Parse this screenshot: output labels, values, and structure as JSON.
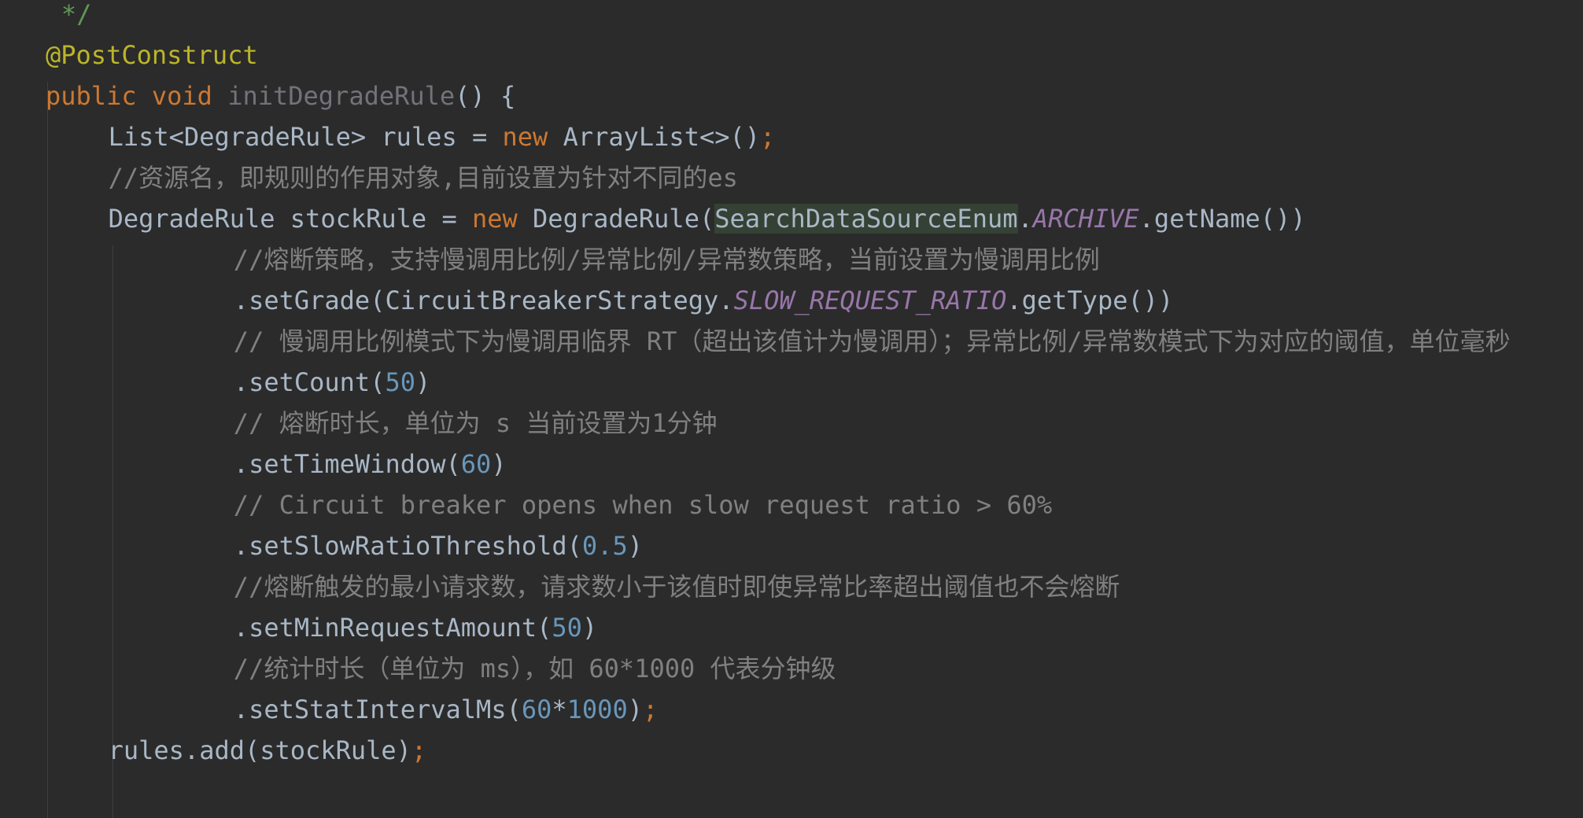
{
  "editor": {
    "lines": [
      {
        "indent": 1,
        "tokens": [
          {
            "t": "*/",
            "c": "doc"
          }
        ]
      },
      {
        "indent": 0,
        "tokens": [
          {
            "t": "@PostConstruct",
            "c": "annotation"
          }
        ]
      },
      {
        "indent": 0,
        "tokens": [
          {
            "t": "public",
            "c": "keyword"
          },
          {
            "t": " ",
            "c": "plain"
          },
          {
            "t": "void",
            "c": "keyword"
          },
          {
            "t": " ",
            "c": "plain"
          },
          {
            "t": "initDegradeRule",
            "c": "unused"
          },
          {
            "t": "() {",
            "c": "plain"
          }
        ]
      },
      {
        "indent": 4,
        "tokens": [
          {
            "t": "List<DegradeRule> rules = ",
            "c": "plain"
          },
          {
            "t": "new",
            "c": "keyword"
          },
          {
            "t": " ArrayList<>()",
            "c": "plain"
          },
          {
            "t": ";",
            "c": "semi"
          }
        ]
      },
      {
        "indent": 4,
        "tokens": [
          {
            "t": "//资源名，即规则的作用对象,目前设置为针对不同的es",
            "c": "comment"
          }
        ]
      },
      {
        "indent": 4,
        "tokens": [
          {
            "t": "DegradeRule stockRule = ",
            "c": "plain"
          },
          {
            "t": "new",
            "c": "keyword"
          },
          {
            "t": " DegradeRule(",
            "c": "plain"
          },
          {
            "t": "SearchDataSourceEnum",
            "c": "highlight"
          },
          {
            "t": ".",
            "c": "plain"
          },
          {
            "t": "ARCHIVE",
            "c": "const"
          },
          {
            "t": ".getName())",
            "c": "plain"
          }
        ]
      },
      {
        "indent": 12,
        "tokens": [
          {
            "t": "//熔断策略，支持慢调用比例/异常比例/异常数策略，当前设置为慢调用比例",
            "c": "comment"
          }
        ]
      },
      {
        "indent": 12,
        "tokens": [
          {
            "t": ".setGrade(CircuitBreakerStrategy.",
            "c": "plain"
          },
          {
            "t": "SLOW_REQUEST_RATIO",
            "c": "const"
          },
          {
            "t": ".getType())",
            "c": "plain"
          }
        ]
      },
      {
        "indent": 12,
        "tokens": [
          {
            "t": "// 慢调用比例模式下为慢调用临界 RT（超出该值计为慢调用）；异常比例/异常数模式下为对应的阈值，单位毫秒",
            "c": "comment"
          }
        ]
      },
      {
        "indent": 12,
        "tokens": [
          {
            "t": ".setCount(",
            "c": "plain"
          },
          {
            "t": "50",
            "c": "number"
          },
          {
            "t": ")",
            "c": "plain"
          }
        ]
      },
      {
        "indent": 12,
        "tokens": [
          {
            "t": "// 熔断时长，单位为 s 当前设置为1分钟",
            "c": "comment"
          }
        ]
      },
      {
        "indent": 12,
        "tokens": [
          {
            "t": ".setTimeWindow(",
            "c": "plain"
          },
          {
            "t": "60",
            "c": "number"
          },
          {
            "t": ")",
            "c": "plain"
          }
        ]
      },
      {
        "indent": 12,
        "tokens": [
          {
            "t": "// Circuit breaker opens when slow request ratio > 60%",
            "c": "comment"
          }
        ]
      },
      {
        "indent": 12,
        "tokens": [
          {
            "t": ".setSlowRatioThreshold(",
            "c": "plain"
          },
          {
            "t": "0.5",
            "c": "number"
          },
          {
            "t": ")",
            "c": "plain"
          }
        ]
      },
      {
        "indent": 12,
        "tokens": [
          {
            "t": "//熔断触发的最小请求数，请求数小于该值时即使异常比率超出阈值也不会熔断",
            "c": "comment"
          }
        ]
      },
      {
        "indent": 12,
        "tokens": [
          {
            "t": ".setMinRequestAmount(",
            "c": "plain"
          },
          {
            "t": "50",
            "c": "number"
          },
          {
            "t": ")",
            "c": "plain"
          }
        ]
      },
      {
        "indent": 12,
        "tokens": [
          {
            "t": "//统计时长（单位为 ms），如 60*1000 代表分钟级",
            "c": "comment"
          }
        ]
      },
      {
        "indent": 12,
        "tokens": [
          {
            "t": ".setStatIntervalMs(",
            "c": "plain"
          },
          {
            "t": "60",
            "c": "number"
          },
          {
            "t": "*",
            "c": "plain"
          },
          {
            "t": "1000",
            "c": "number"
          },
          {
            "t": ")",
            "c": "plain"
          },
          {
            "t": ";",
            "c": "semi"
          }
        ]
      },
      {
        "indent": 4,
        "tokens": [
          {
            "t": "rules.add(stockRule)",
            "c": "plain"
          },
          {
            "t": ";",
            "c": "semi"
          }
        ]
      }
    ]
  }
}
